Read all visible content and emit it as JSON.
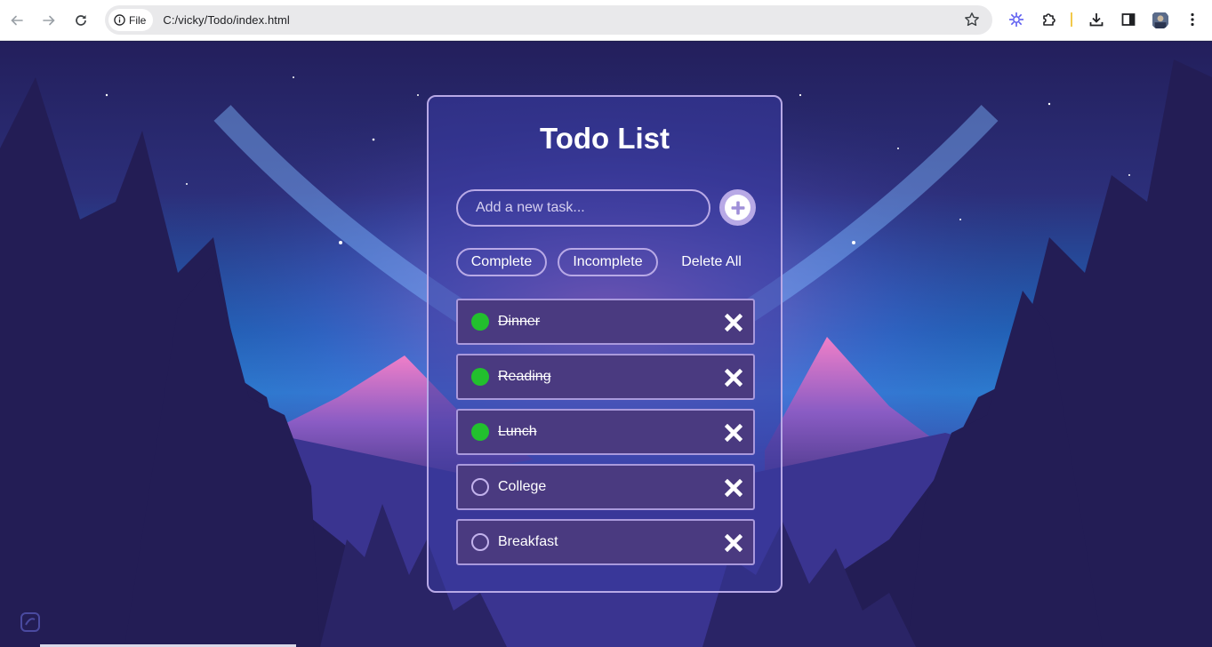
{
  "browser": {
    "site_chip_label": "File",
    "url": "C:/vicky/Todo/index.html"
  },
  "app": {
    "title": "Todo List",
    "input_placeholder": "Add a new task...",
    "filters": {
      "complete": "Complete",
      "incomplete": "Incomplete",
      "delete_all": "Delete All"
    },
    "todos": [
      {
        "text": "Dinner",
        "completed": true
      },
      {
        "text": "Reading",
        "completed": true
      },
      {
        "text": "Lunch",
        "completed": true
      },
      {
        "text": "College",
        "completed": false
      },
      {
        "text": "Breakfast",
        "completed": false
      }
    ]
  },
  "icons": {
    "back": "arrow-left-icon",
    "forward": "arrow-right-icon",
    "reload": "reload-icon",
    "info": "info-icon",
    "bookmark": "star-icon",
    "add": "plus-icon",
    "remove": "close-icon",
    "complete": "check-circle-icon"
  },
  "colors": {
    "accent": "#b8a9e6",
    "complete_dot": "#22c02e",
    "item_bg": "#4a3a80"
  }
}
